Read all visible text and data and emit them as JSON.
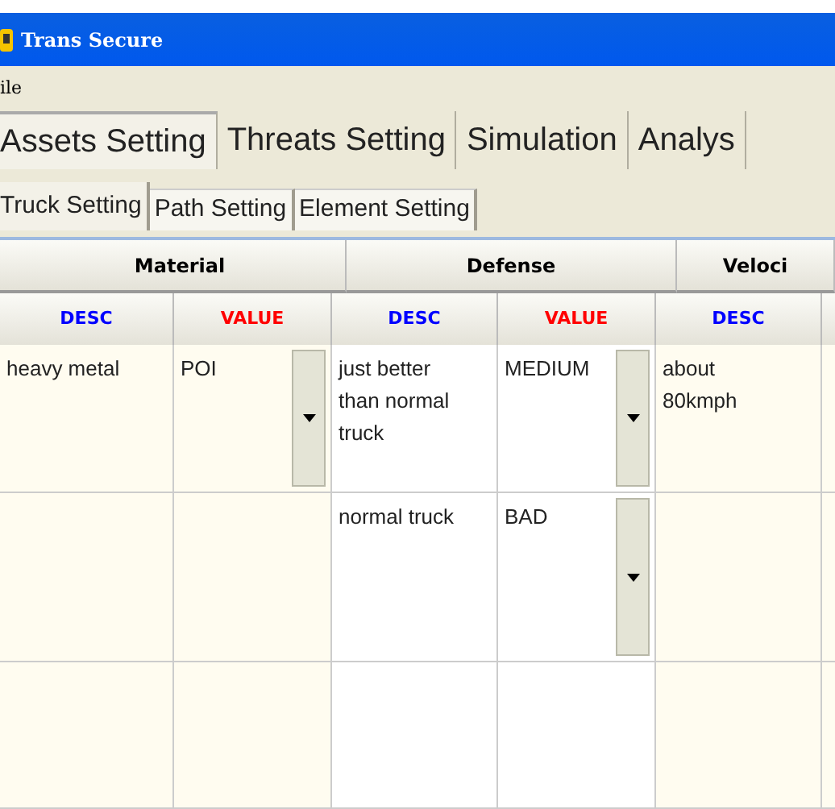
{
  "window": {
    "title": "Trans Secure"
  },
  "menu": [
    "ile"
  ],
  "tabs": [
    {
      "label": "Assets Setting",
      "selected": true
    },
    {
      "label": "Threats Setting",
      "selected": false
    },
    {
      "label": "Simulation",
      "selected": false
    },
    {
      "label": "Analys",
      "selected": false
    }
  ],
  "subtabs": [
    {
      "label": "Truck Setting",
      "selected": true
    },
    {
      "label": "Path Setting",
      "selected": false
    },
    {
      "label": "Element Setting",
      "selected": false
    }
  ],
  "table": {
    "groups": [
      {
        "label": "Material"
      },
      {
        "label": "Defense"
      },
      {
        "label": "Veloci"
      }
    ],
    "columns": [
      {
        "label": "DESC",
        "kind": "desc"
      },
      {
        "label": "VALUE",
        "kind": "value"
      },
      {
        "label": "DESC",
        "kind": "desc"
      },
      {
        "label": "VALUE",
        "kind": "value"
      },
      {
        "label": "DESC",
        "kind": "desc"
      }
    ],
    "rows": [
      {
        "cells": [
          {
            "text": "heavy metal"
          },
          {
            "text": "POI",
            "dropdown": true
          },
          {
            "text": "just better than normal truck"
          },
          {
            "text": "MEDIUM",
            "dropdown": true
          },
          {
            "text": "about 80kmph"
          }
        ]
      },
      {
        "cells": [
          {},
          {},
          {
            "text": "normal truck"
          },
          {
            "text": "BAD",
            "dropdown": true
          },
          {}
        ]
      },
      {
        "cells": [
          {},
          {},
          {},
          {},
          {}
        ]
      }
    ]
  }
}
